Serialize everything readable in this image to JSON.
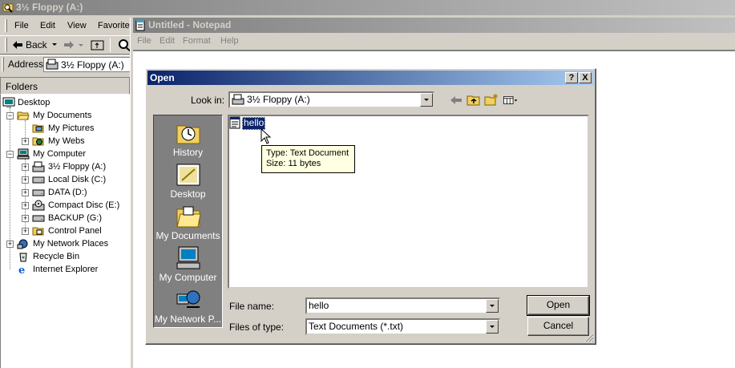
{
  "explorer": {
    "title": "3½ Floppy (A:)",
    "menu": [
      "File",
      "Edit",
      "View",
      "Favorite"
    ],
    "back_label": "Back",
    "address_label": "Address",
    "address_value": "3½ Floppy (A:)",
    "folders_label": "Folders",
    "tree": [
      {
        "label": "Desktop",
        "icon": "desktop-icon"
      },
      {
        "label": "My Documents",
        "icon": "folder-open-icon"
      },
      {
        "label": "My Pictures",
        "icon": "pictures-folder-icon"
      },
      {
        "label": "My Webs",
        "icon": "webs-folder-icon"
      },
      {
        "label": "My Computer",
        "icon": "computer-icon"
      },
      {
        "label": "3½ Floppy (A:)",
        "icon": "floppy-icon"
      },
      {
        "label": "Local Disk (C:)",
        "icon": "hard-disk-icon"
      },
      {
        "label": "DATA (D:)",
        "icon": "hard-disk-icon"
      },
      {
        "label": "Compact Disc (E:)",
        "icon": "cd-drive-icon"
      },
      {
        "label": "BACKUP (G:)",
        "icon": "hard-disk-icon"
      },
      {
        "label": "Control Panel",
        "icon": "control-panel-icon"
      },
      {
        "label": "My Network Places",
        "icon": "network-icon"
      },
      {
        "label": "Recycle Bin",
        "icon": "recycle-bin-icon"
      },
      {
        "label": "Internet Explorer",
        "icon": "ie-icon"
      }
    ]
  },
  "notepad": {
    "title": "Untitled - Notepad",
    "menu": [
      "File",
      "Edit",
      "Format",
      "Help"
    ]
  },
  "dialog": {
    "title": "Open",
    "help_btn": "?",
    "close_btn": "X",
    "look_in_label": "Look in:",
    "look_in_value": "3½ Floppy (A:)",
    "places": [
      "History",
      "Desktop",
      "My Documents",
      "My Computer",
      "My Network P..."
    ],
    "files": [
      {
        "name": "hello",
        "icon": "text-file-icon"
      }
    ],
    "tooltip_type": "Type: Text Document",
    "tooltip_size": "Size: 11 bytes",
    "file_name_label": "File name:",
    "file_name_value": "hello",
    "file_type_label": "Files of type:",
    "file_type_value": "Text Documents (*.txt)",
    "open_btn": "Open",
    "cancel_btn": "Cancel"
  },
  "colors": {
    "active_title": "#0a246a",
    "inactive_title": "#808080",
    "face": "#d4d0c8",
    "tooltip_bg": "#ffffe1"
  }
}
